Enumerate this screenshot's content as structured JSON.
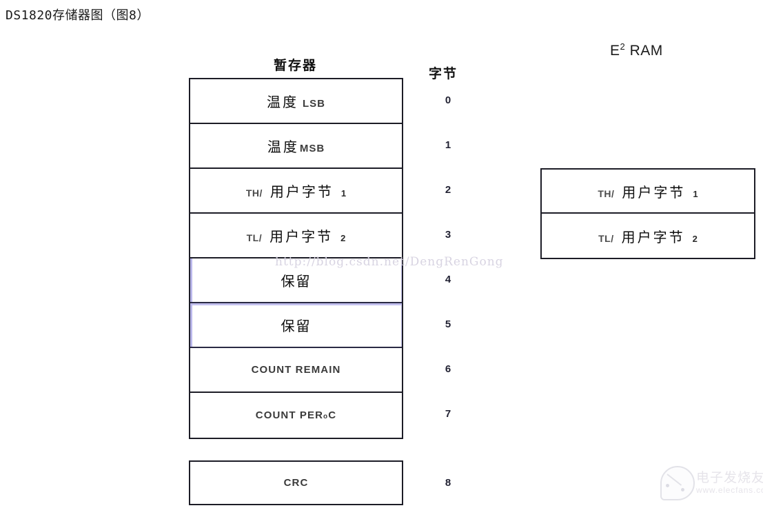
{
  "title": "DS1820存储器图（图8）",
  "headers": {
    "scratchpad": "暂存器",
    "byte": "字节",
    "eeram_prefix": "E",
    "eeram_sup": "2",
    "eeram_suffix": " RAM"
  },
  "scratchpad_rows": [
    {
      "byte": "0",
      "prefix": "",
      "main": "温度",
      "suffix": "LSB",
      "index": "",
      "style": "cn-lsb",
      "tint": false
    },
    {
      "byte": "1",
      "prefix": "",
      "main": "温度",
      "suffix": "MSB",
      "index": "",
      "style": "cn-msb",
      "tint": false
    },
    {
      "byte": "2",
      "prefix": "TH/",
      "main": "用户字节",
      "suffix": "",
      "index": "1",
      "style": "cn-user",
      "tint": false
    },
    {
      "byte": "3",
      "prefix": "TL/",
      "main": "用户字节",
      "suffix": "",
      "index": "2",
      "style": "cn-user",
      "tint": false
    },
    {
      "byte": "4",
      "prefix": "",
      "main": "保留",
      "suffix": "",
      "index": "",
      "style": "cn-plain",
      "tint": true
    },
    {
      "byte": "5",
      "prefix": "",
      "main": "保留",
      "suffix": "",
      "index": "",
      "style": "cn-plain",
      "tint": true
    },
    {
      "byte": "6",
      "prefix": "",
      "main": "COUNT REMAIN",
      "suffix": "",
      "index": "",
      "style": "latin",
      "tint": false
    },
    {
      "byte": "7",
      "prefix": "",
      "main": "COUNT PER ",
      "suffix": "",
      "index": "",
      "style": "latin-deg",
      "tint": false
    }
  ],
  "crc_row": {
    "byte": "8",
    "label": "CRC"
  },
  "count_per_degree": {
    "text": "COUNT PER ",
    "sup": "o",
    "unit": "C"
  },
  "eeram_rows": [
    {
      "prefix": "TH/",
      "main": "用户字节",
      "index": "1"
    },
    {
      "prefix": "TL/",
      "main": "用户字节",
      "index": "2"
    }
  ],
  "watermarks": {
    "blog_url": "http://blog.csdn.net/DengRenGong",
    "logo_name": "电子发烧友",
    "logo_url": "www.elecfans.com"
  },
  "colors": {
    "border": "#1c1c26",
    "tint": "#b9b6ea",
    "background": "#ffffff",
    "text": "#0d0d0d",
    "watermark": "#d8d4e2"
  }
}
